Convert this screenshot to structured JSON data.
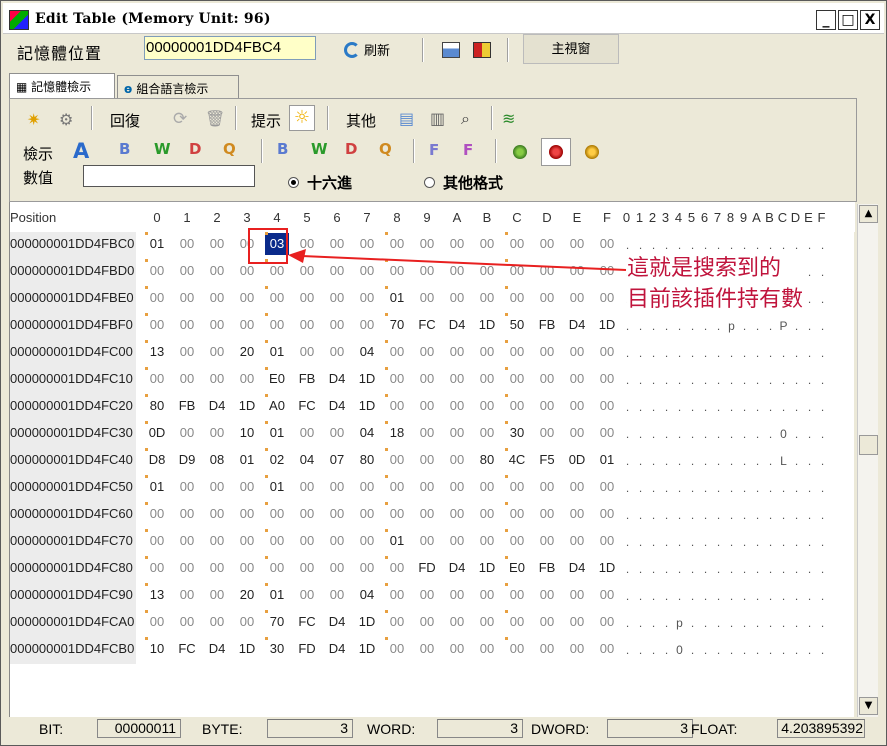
{
  "window": {
    "title": "Edit Table (Memory Unit: 96)",
    "min": "_",
    "max": "□",
    "close": "X"
  },
  "toolbar1": {
    "address_label": "記憶體位置",
    "address_value": "00000001DD4FBC4",
    "refresh_label": "刷新",
    "main_window_label": "主視窗"
  },
  "tabs": [
    {
      "label": "記憶體檢示",
      "active": true
    },
    {
      "label": "組合語言檢示",
      "active": false
    }
  ],
  "toolbar2": {
    "undo_label": "回復",
    "hint_label": "提示",
    "other_label": "其他"
  },
  "toolbar3": {
    "view_label": "檢示",
    "dec_icons": [
      "B",
      "W",
      "D",
      "Q"
    ],
    "hex_icons": [
      "B",
      "W",
      "D",
      "Q"
    ]
  },
  "value_row": {
    "label": "數值",
    "value": "",
    "radio_hex": "十六進",
    "radio_other": "其他格式"
  },
  "grid": {
    "position_header": "Position",
    "byte_headers": [
      "0",
      "1",
      "2",
      "3",
      "4",
      "5",
      "6",
      "7",
      "8",
      "9",
      "A",
      "B",
      "C",
      "D",
      "E",
      "F"
    ],
    "ascii_headers": [
      "0",
      "1",
      "2",
      "3",
      "4",
      "5",
      "6",
      "7",
      "8",
      "9",
      "A",
      "B",
      "C",
      "D",
      "E",
      "F"
    ],
    "rows": [
      {
        "addr": "000000001DD4FBC0",
        "bytes": [
          "01",
          "00",
          "00",
          "00",
          "03",
          "00",
          "00",
          "00",
          "00",
          "00",
          "00",
          "00",
          "00",
          "00",
          "00",
          "00"
        ],
        "ascii": [
          ".",
          ".",
          ".",
          ".",
          ".",
          ".",
          ".",
          ".",
          ".",
          ".",
          ".",
          ".",
          ".",
          ".",
          ".",
          "."
        ]
      },
      {
        "addr": "000000001DD4FBD0",
        "bytes": [
          "00",
          "00",
          "00",
          "00",
          "00",
          "00",
          "00",
          "00",
          "00",
          "00",
          "00",
          "00",
          "00",
          "00",
          "00",
          "00"
        ],
        "ascii": [
          ".",
          ".",
          ".",
          ".",
          ".",
          ".",
          ".",
          ".",
          ".",
          ".",
          ".",
          ".",
          ".",
          ".",
          ".",
          "."
        ]
      },
      {
        "addr": "000000001DD4FBE0",
        "bytes": [
          "00",
          "00",
          "00",
          "00",
          "00",
          "00",
          "00",
          "00",
          "01",
          "00",
          "00",
          "00",
          "00",
          "00",
          "00",
          "00"
        ],
        "ascii": [
          ".",
          ".",
          ".",
          ".",
          ".",
          ".",
          ".",
          ".",
          ".",
          ".",
          ".",
          ".",
          ".",
          ".",
          ".",
          "."
        ]
      },
      {
        "addr": "000000001DD4FBF0",
        "bytes": [
          "00",
          "00",
          "00",
          "00",
          "00",
          "00",
          "00",
          "00",
          "70",
          "FC",
          "D4",
          "1D",
          "50",
          "FB",
          "D4",
          "1D"
        ],
        "ascii": [
          ".",
          ".",
          ".",
          ".",
          ".",
          ".",
          ".",
          ".",
          "p",
          ".",
          ".",
          ".",
          "P",
          ".",
          ".",
          "."
        ]
      },
      {
        "addr": "000000001DD4FC00",
        "bytes": [
          "13",
          "00",
          "00",
          "20",
          "01",
          "00",
          "00",
          "04",
          "00",
          "00",
          "00",
          "00",
          "00",
          "00",
          "00",
          "00"
        ],
        "ascii": [
          ".",
          ".",
          ".",
          ".",
          ".",
          ".",
          ".",
          ".",
          ".",
          ".",
          ".",
          ".",
          ".",
          ".",
          ".",
          "."
        ]
      },
      {
        "addr": "000000001DD4FC10",
        "bytes": [
          "00",
          "00",
          "00",
          "00",
          "E0",
          "FB",
          "D4",
          "1D",
          "00",
          "00",
          "00",
          "00",
          "00",
          "00",
          "00",
          "00"
        ],
        "ascii": [
          ".",
          ".",
          ".",
          ".",
          ".",
          ".",
          ".",
          ".",
          ".",
          ".",
          ".",
          ".",
          ".",
          ".",
          ".",
          "."
        ]
      },
      {
        "addr": "000000001DD4FC20",
        "bytes": [
          "80",
          "FB",
          "D4",
          "1D",
          "A0",
          "FC",
          "D4",
          "1D",
          "00",
          "00",
          "00",
          "00",
          "00",
          "00",
          "00",
          "00"
        ],
        "ascii": [
          ".",
          ".",
          ".",
          ".",
          ".",
          ".",
          ".",
          ".",
          ".",
          ".",
          ".",
          ".",
          ".",
          ".",
          ".",
          "."
        ]
      },
      {
        "addr": "000000001DD4FC30",
        "bytes": [
          "0D",
          "00",
          "00",
          "10",
          "01",
          "00",
          "00",
          "04",
          "18",
          "00",
          "00",
          "00",
          "30",
          "00",
          "00",
          "00"
        ],
        "ascii": [
          ".",
          ".",
          ".",
          ".",
          ".",
          ".",
          ".",
          ".",
          ".",
          ".",
          ".",
          ".",
          "0",
          ".",
          ".",
          "."
        ]
      },
      {
        "addr": "000000001DD4FC40",
        "bytes": [
          "D8",
          "D9",
          "08",
          "01",
          "02",
          "04",
          "07",
          "80",
          "00",
          "00",
          "00",
          "80",
          "4C",
          "F5",
          "0D",
          "01"
        ],
        "ascii": [
          ".",
          ".",
          ".",
          ".",
          ".",
          ".",
          ".",
          ".",
          ".",
          ".",
          ".",
          ".",
          "L",
          ".",
          ".",
          "."
        ]
      },
      {
        "addr": "000000001DD4FC50",
        "bytes": [
          "01",
          "00",
          "00",
          "00",
          "01",
          "00",
          "00",
          "00",
          "00",
          "00",
          "00",
          "00",
          "00",
          "00",
          "00",
          "00"
        ],
        "ascii": [
          ".",
          ".",
          ".",
          ".",
          ".",
          ".",
          ".",
          ".",
          ".",
          ".",
          ".",
          ".",
          ".",
          ".",
          ".",
          "."
        ]
      },
      {
        "addr": "000000001DD4FC60",
        "bytes": [
          "00",
          "00",
          "00",
          "00",
          "00",
          "00",
          "00",
          "00",
          "00",
          "00",
          "00",
          "00",
          "00",
          "00",
          "00",
          "00"
        ],
        "ascii": [
          ".",
          ".",
          ".",
          ".",
          ".",
          ".",
          ".",
          ".",
          ".",
          ".",
          ".",
          ".",
          ".",
          ".",
          ".",
          "."
        ]
      },
      {
        "addr": "000000001DD4FC70",
        "bytes": [
          "00",
          "00",
          "00",
          "00",
          "00",
          "00",
          "00",
          "00",
          "01",
          "00",
          "00",
          "00",
          "00",
          "00",
          "00",
          "00"
        ],
        "ascii": [
          ".",
          ".",
          ".",
          ".",
          ".",
          ".",
          ".",
          ".",
          ".",
          ".",
          ".",
          ".",
          ".",
          ".",
          ".",
          "."
        ]
      },
      {
        "addr": "000000001DD4FC80",
        "bytes": [
          "00",
          "00",
          "00",
          "00",
          "00",
          "00",
          "00",
          "00",
          "00",
          "FD",
          "D4",
          "1D",
          "E0",
          "FB",
          "D4",
          "1D"
        ],
        "ascii": [
          ".",
          ".",
          ".",
          ".",
          ".",
          ".",
          ".",
          ".",
          ".",
          ".",
          ".",
          ".",
          ".",
          ".",
          ".",
          "."
        ]
      },
      {
        "addr": "000000001DD4FC90",
        "bytes": [
          "13",
          "00",
          "00",
          "20",
          "01",
          "00",
          "00",
          "04",
          "00",
          "00",
          "00",
          "00",
          "00",
          "00",
          "00",
          "00"
        ],
        "ascii": [
          ".",
          ".",
          ".",
          ".",
          ".",
          ".",
          ".",
          ".",
          ".",
          ".",
          ".",
          ".",
          ".",
          ".",
          ".",
          "."
        ]
      },
      {
        "addr": "000000001DD4FCA0",
        "bytes": [
          "00",
          "00",
          "00",
          "00",
          "70",
          "FC",
          "D4",
          "1D",
          "00",
          "00",
          "00",
          "00",
          "00",
          "00",
          "00",
          "00"
        ],
        "ascii": [
          ".",
          ".",
          ".",
          ".",
          "p",
          ".",
          ".",
          ".",
          ".",
          ".",
          ".",
          ".",
          ".",
          ".",
          ".",
          "."
        ]
      },
      {
        "addr": "000000001DD4FCB0",
        "bytes": [
          "10",
          "FC",
          "D4",
          "1D",
          "30",
          "FD",
          "D4",
          "1D",
          "00",
          "00",
          "00",
          "00",
          "00",
          "00",
          "00",
          "00"
        ],
        "ascii": [
          ".",
          ".",
          ".",
          ".",
          "0",
          ".",
          ".",
          ".",
          ".",
          ".",
          ".",
          ".",
          ".",
          ".",
          ".",
          "."
        ]
      }
    ],
    "selected": {
      "row": 0,
      "col": 4
    }
  },
  "annotation": {
    "line1": "這就是搜索到的",
    "line2": "目前該插件持有數",
    "color": "#c0143c"
  },
  "status": {
    "bit_label": "BIT:",
    "bit_value": "00000011",
    "byte_label": "BYTE:",
    "byte_value": "3",
    "word_label": "WORD:",
    "word_value": "3",
    "dword_label": "DWORD:",
    "dword_value": "3",
    "float_label": "FLOAT:",
    "float_value": "4.203895392"
  }
}
